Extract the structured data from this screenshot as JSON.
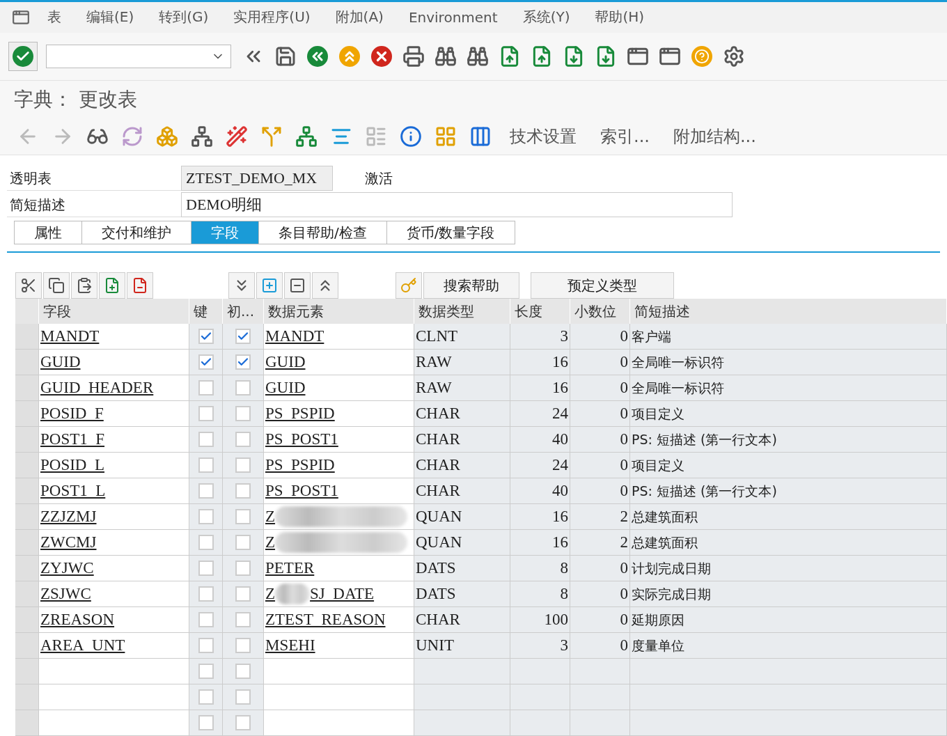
{
  "menu_bar": {
    "items": [
      "表",
      "编辑(E)",
      "转到(G)",
      "实用程序(U)",
      "附加(A)",
      "Environment",
      "系统(Y)",
      "帮助(H)"
    ]
  },
  "page_title": "字典： 更改表",
  "app_toolbar": {
    "text_buttons": [
      "技术设置",
      "索引...",
      "附加结构..."
    ]
  },
  "header": {
    "table_label": "透明表",
    "table_name": "ZTEST_DEMO_MX",
    "status": "激活",
    "desc_label": "简短描述",
    "desc_value": "DEMO明细"
  },
  "tabs": [
    {
      "label": "属性",
      "selected": false
    },
    {
      "label": "交付和维护",
      "selected": false
    },
    {
      "label": "字段",
      "selected": true
    },
    {
      "label": "条目帮助/检查",
      "selected": false
    },
    {
      "label": "货币/数量字段",
      "selected": false
    }
  ],
  "table_toolbar": {
    "buttons": [
      "搜索帮助",
      "预定义类型"
    ]
  },
  "table": {
    "columns": [
      "字段",
      "键",
      "初...",
      "数据元素",
      "数据类型",
      "长度",
      "小数位",
      "简短描述"
    ],
    "rows": [
      {
        "kind": "field",
        "field": "MANDT",
        "key": true,
        "initial": true,
        "data_element": "MANDT",
        "type": "CLNT",
        "length": "3",
        "decimals": "0",
        "description": "客户端"
      },
      {
        "kind": "field",
        "field": "GUID",
        "key": true,
        "initial": true,
        "data_element": "GUID",
        "type": "RAW",
        "length": "16",
        "decimals": "0",
        "description": "全局唯一标识符"
      },
      {
        "kind": "field",
        "field": "GUID_HEADER",
        "key": false,
        "initial": false,
        "data_element": "GUID",
        "type": "RAW",
        "length": "16",
        "decimals": "0",
        "description": "全局唯一标识符"
      },
      {
        "kind": "field",
        "field": "POSID_F",
        "key": false,
        "initial": false,
        "data_element": "PS_PSPID",
        "type": "CHAR",
        "length": "24",
        "decimals": "0",
        "description": "项目定义"
      },
      {
        "kind": "field",
        "field": "POST1_F",
        "key": false,
        "initial": false,
        "data_element": "PS_POST1",
        "type": "CHAR",
        "length": "40",
        "decimals": "0",
        "description": "PS: 短描述 (第一行文本)"
      },
      {
        "kind": "field",
        "field": "POSID_L",
        "key": false,
        "initial": false,
        "data_element": "PS_PSPID",
        "type": "CHAR",
        "length": "24",
        "decimals": "0",
        "description": "项目定义"
      },
      {
        "kind": "field",
        "field": "POST1_L",
        "key": false,
        "initial": false,
        "data_element": "PS_POST1",
        "type": "CHAR",
        "length": "40",
        "decimals": "0",
        "description": "PS: 短描述 (第一行文本)"
      },
      {
        "kind": "field",
        "field": "ZZJZMJ",
        "key": false,
        "initial": false,
        "data_element": "Z",
        "redacted": true,
        "type": "QUAN",
        "length": "16",
        "decimals": "2",
        "description": "总建筑面积"
      },
      {
        "kind": "field",
        "field": "ZWCMJ",
        "key": false,
        "initial": false,
        "data_element": "Z",
        "redacted": true,
        "type": "QUAN",
        "length": "16",
        "decimals": "2",
        "description": "总建筑面积"
      },
      {
        "kind": "field",
        "field": "ZYJWC",
        "key": false,
        "initial": false,
        "data_element": "PETER",
        "type": "DATS",
        "length": "8",
        "decimals": "0",
        "description": "计划完成日期"
      },
      {
        "kind": "field",
        "field": "ZSJWC",
        "key": false,
        "initial": false,
        "data_element": "Z",
        "redacted": true,
        "data_element_tail": "SJ_DATE",
        "type": "DATS",
        "length": "8",
        "decimals": "0",
        "description": "实际完成日期"
      },
      {
        "kind": "field",
        "field": "ZREASON",
        "key": false,
        "initial": false,
        "data_element": "ZTEST_REASON",
        "type": "CHAR",
        "length": "100",
        "decimals": "0",
        "description": "延期原因"
      },
      {
        "kind": "field",
        "field": "AREA_UNT",
        "key": false,
        "initial": false,
        "data_element": "MSEHI",
        "type": "UNIT",
        "length": "3",
        "decimals": "0",
        "description": "度量单位"
      },
      {
        "kind": "empty",
        "key": false,
        "initial": false
      },
      {
        "kind": "empty",
        "key": false,
        "initial": false
      },
      {
        "kind": "empty",
        "key": false,
        "initial": false
      }
    ]
  }
}
